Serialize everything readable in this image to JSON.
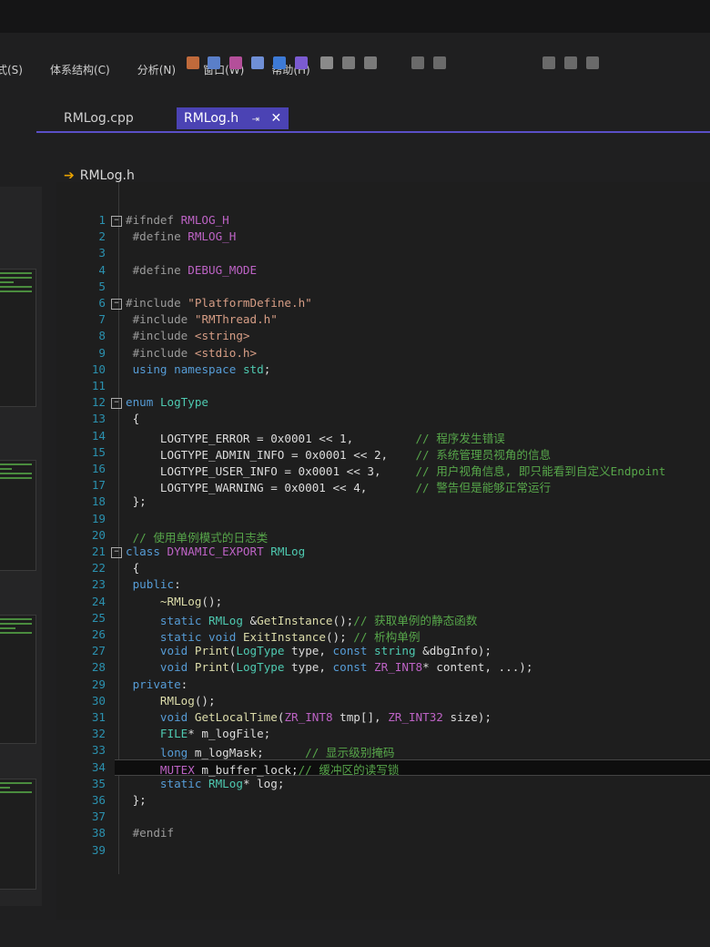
{
  "menu": [
    "式(S)",
    "体系结构(C)",
    "分析(N)",
    "窗口(W)",
    "帮助(H)"
  ],
  "tabs": [
    {
      "label": "RMLog.cpp",
      "active": false
    },
    {
      "label": "RMLog.h",
      "active": true,
      "pin": "⇥",
      "close": "✕"
    }
  ],
  "nav": {
    "file": "RMLog.h",
    "class": "RMLog"
  },
  "colors": {
    "accent": "#4b43b4",
    "keyword": "#569cd6",
    "macro": "#bd63c5",
    "comment": "#57a64a",
    "linenumber": "#2b91af"
  },
  "code": {
    "lines": [
      {
        "n": "1",
        "fold": "−",
        "html": "<span class='pp'>#ifndef</span> <span class='mac'>RMLOG_H</span>"
      },
      {
        "n": "2",
        "html": " <span class='pp'>#define</span> <span class='mac'>RMLOG_H</span>"
      },
      {
        "n": "3",
        "html": ""
      },
      {
        "n": "4",
        "html": " <span class='pp'>#define</span> <span class='mac'>DEBUG_MODE</span>"
      },
      {
        "n": "5",
        "html": ""
      },
      {
        "n": "6",
        "fold": "−",
        "html": "<span class='pp'>#include</span> <span class='str'>\"PlatformDefine.h\"</span>"
      },
      {
        "n": "7",
        "html": " <span class='pp'>#include</span> <span class='str'>\"RMThread.h\"</span>"
      },
      {
        "n": "8",
        "html": " <span class='pp'>#include</span> <span class='str'>&lt;string&gt;</span>"
      },
      {
        "n": "9",
        "html": " <span class='pp'>#include</span> <span class='str'>&lt;stdio.h&gt;</span>"
      },
      {
        "n": "10",
        "html": " <span class='kw'>using</span> <span class='kw'>namespace</span> <span class='typ'>std</span>;"
      },
      {
        "n": "11",
        "html": ""
      },
      {
        "n": "12",
        "fold": "−",
        "html": "<span class='kw'>enum</span> <span class='typ'>LogType</span>"
      },
      {
        "n": "13",
        "html": " {"
      },
      {
        "n": "14",
        "html": "     LOGTYPE_ERROR = 0x0001 &lt;&lt; 1,         <span class='cm'>// 程序发生错误</span>"
      },
      {
        "n": "15",
        "html": "     LOGTYPE_ADMIN_INFO = 0x0001 &lt;&lt; 2,    <span class='cm'>// 系统管理员视角的信息</span>"
      },
      {
        "n": "16",
        "html": "     LOGTYPE_USER_INFO = 0x0001 &lt;&lt; 3,     <span class='cm'>// 用户视角信息, 即只能看到自定义Endpoint</span>"
      },
      {
        "n": "17",
        "html": "     LOGTYPE_WARNING = 0x0001 &lt;&lt; 4,       <span class='cm'>// 警告但是能够正常运行</span>"
      },
      {
        "n": "18",
        "html": " };"
      },
      {
        "n": "19",
        "html": ""
      },
      {
        "n": "20",
        "html": " <span class='cm'>// 使用单例模式的日志类</span>"
      },
      {
        "n": "21",
        "fold": "−",
        "html": "<span class='kw'>class</span> <span class='mac'>DYNAMIC_EXPORT</span> <span class='typ'>RMLog</span>"
      },
      {
        "n": "22",
        "html": " {"
      },
      {
        "n": "23",
        "html": " <span class='kw'>public</span>:"
      },
      {
        "n": "24",
        "html": "     <span class='fn'>~RMLog</span>();"
      },
      {
        "n": "25",
        "html": "     <span class='kw'>static</span> <span class='typ'>RMLog</span> &amp;<span class='fn'>GetInstance</span>();<span class='cm'>// 获取单例的静态函数</span>"
      },
      {
        "n": "26",
        "html": "     <span class='kw'>static</span> <span class='kw'>void</span> <span class='fn'>ExitInstance</span>(); <span class='cm'>// 析构单例</span>"
      },
      {
        "n": "27",
        "html": "     <span class='kw'>void</span> <span class='fn'>Print</span>(<span class='typ'>LogType</span> type, <span class='kw'>const</span> <span class='typ'>string</span> &amp;dbgInfo);"
      },
      {
        "n": "28",
        "html": "     <span class='kw'>void</span> <span class='fn'>Print</span>(<span class='typ'>LogType</span> type, <span class='kw'>const</span> <span class='mac'>ZR_INT8</span>* content, ...);"
      },
      {
        "n": "29",
        "html": " <span class='kw'>private</span>:"
      },
      {
        "n": "30",
        "html": "     <span class='fn'>RMLog</span>();"
      },
      {
        "n": "31",
        "html": "     <span class='kw'>void</span> <span class='fn'>GetLocalTime</span>(<span class='mac'>ZR_INT8</span> tmp[], <span class='mac'>ZR_INT32</span> size);"
      },
      {
        "n": "32",
        "html": "     <span class='typ'>FILE</span>* m_logFile;"
      },
      {
        "n": "33",
        "html": "     <span class='kw'>long</span> m_logMask;      <span class='cm'>// 显示级别掩码</span>"
      },
      {
        "n": "34",
        "hl": true,
        "html": "     <span class='mac'>MUTEX</span> m_buffer_lock;<span class='cm'>// 缓冲区的读写锁</span>"
      },
      {
        "n": "35",
        "html": "     <span class='kw'>static</span> <span class='typ'>RMLog</span>* log;"
      },
      {
        "n": "36",
        "html": " };"
      },
      {
        "n": "37",
        "html": ""
      },
      {
        "n": "38",
        "html": " <span class='pp'>#endif</span>"
      },
      {
        "n": "39",
        "html": ""
      }
    ]
  }
}
